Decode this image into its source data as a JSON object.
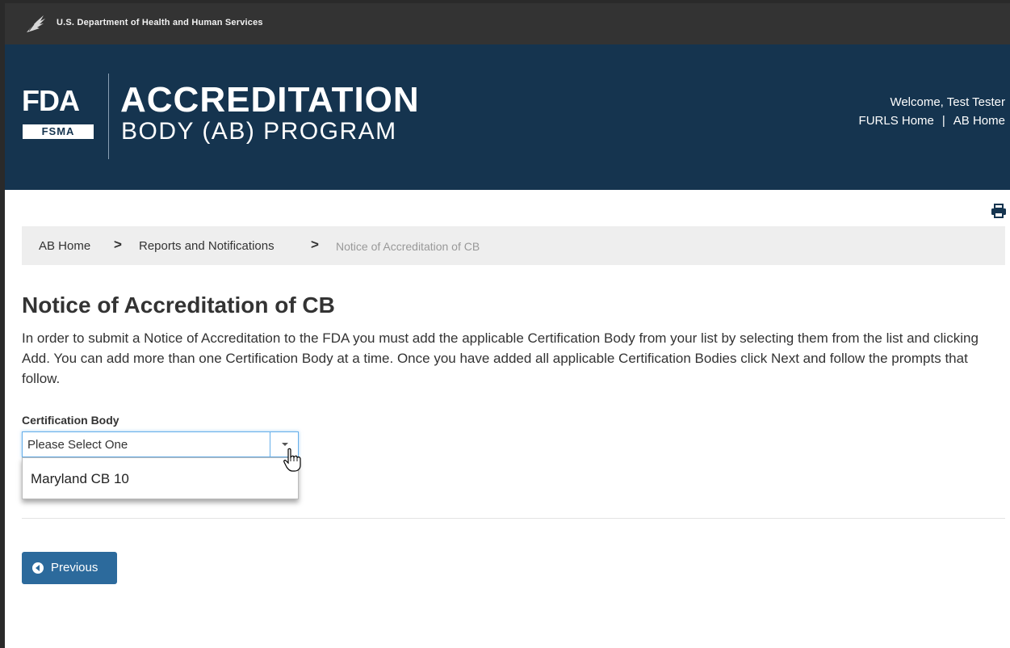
{
  "hhs_bar": {
    "agency_text": "U.S. Department of Health and Human Services",
    "icon": "hhs-eagle-icon"
  },
  "banner": {
    "logo_letters": "FDA",
    "logo_badge": "FSMA",
    "title_line1": "ACCREDITATION",
    "title_line2": "BODY (AB) PROGRAM",
    "welcome": "Welcome, Test Tester",
    "links": {
      "furls_home": "FURLS Home",
      "separator": "|",
      "ab_home": "AB Home"
    }
  },
  "toolbar": {
    "print_icon": "print-icon"
  },
  "breadcrumb": {
    "items": [
      {
        "label": "AB Home"
      },
      {
        "label": "Reports and Notifications"
      },
      {
        "label": "Notice of Accreditation of CB"
      }
    ],
    "separator_icon": "chevron-right-icon",
    "separator_glyph": ">"
  },
  "main": {
    "title": "Notice of Accreditation of CB",
    "intro": "In order to submit a Notice of Accreditation to the FDA you must add the applicable Certification Body from your list by selecting them from the list and clicking Add. You can add more than one Certification Body at a time. Once you have added all applicable Certification Bodies click Next and follow the prompts that follow.",
    "certification_body": {
      "label": "Certification Body",
      "selected": "Please Select One",
      "options": [
        "Maryland CB 10"
      ]
    },
    "previous_button": "Previous"
  },
  "colors": {
    "top_bar": "#333333",
    "banner": "#15344f",
    "primary_button": "#2c6a9c",
    "breadcrumb_bg": "#eeeeee",
    "focus_border": "#66afe9"
  }
}
